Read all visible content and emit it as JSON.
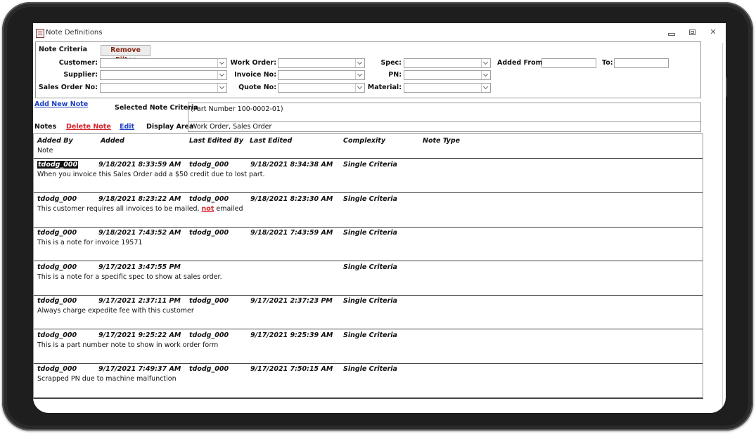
{
  "window": {
    "title": "Note Definitions"
  },
  "criteria": {
    "heading": "Note Criteria",
    "remove_filter": "Remove Filter",
    "labels": {
      "customer": "Customer:",
      "supplier": "Supplier:",
      "sales_order_no": "Sales Order No:",
      "work_order": "Work Order:",
      "invoice_no": "Invoice No:",
      "quote_no": "Quote No:",
      "spec": "Spec:",
      "pn": "PN:",
      "material": "Material:",
      "added_from": "Added From:",
      "to": "To:"
    }
  },
  "actions": {
    "add_new_note": "Add New Note",
    "selected_label": "Selected Note Criteria",
    "selected_value": "(Part Number 100-0002-01)",
    "notes_label": "Notes",
    "delete_note": "Delete Note",
    "edit": "Edit",
    "display_area_label": "Display Area",
    "display_area_value": "Work Order, Sales Order"
  },
  "grid": {
    "headers": {
      "added_by": "Added By",
      "added": "Added",
      "last_edited_by": "Last Edited By",
      "last_edited": "Last Edited",
      "complexity": "Complexity",
      "note_type": "Note Type",
      "note": "Note"
    },
    "rows": [
      {
        "added_by": "tdodg_000",
        "added": "9/18/2021 8:33:59 AM",
        "last_edited_by": "tdodg_000",
        "last_edited": "9/18/2021 8:34:38 AM",
        "complexity": "Single Criteria",
        "note": "When you invoice this Sales Order add a $50 credit due to lost part."
      },
      {
        "added_by": "tdodg_000",
        "added": "9/18/2021 8:23:22 AM",
        "last_edited_by": "tdodg_000",
        "last_edited": "9/18/2021 8:23:30 AM",
        "complexity": "Single Criteria",
        "note_pre": "This customer requires all invoices to be mailed, ",
        "note_emph": "not",
        "note_post": " emailed"
      },
      {
        "added_by": "tdodg_000",
        "added": "9/18/2021 7:43:52 AM",
        "last_edited_by": "tdodg_000",
        "last_edited": "9/18/2021 7:43:59 AM",
        "complexity": "Single Criteria",
        "note": "This is a note for invoice 19571"
      },
      {
        "added_by": "tdodg_000",
        "added": "9/17/2021 3:47:55 PM",
        "last_edited_by": "",
        "last_edited": "",
        "complexity": "Single Criteria",
        "note": "This is a note for a specific spec to show at sales order."
      },
      {
        "added_by": "tdodg_000",
        "added": "9/17/2021 2:37:11 PM",
        "last_edited_by": "tdodg_000",
        "last_edited": "9/17/2021 2:37:23 PM",
        "complexity": "Single Criteria",
        "note": "Always charge expedite fee with this customer"
      },
      {
        "added_by": "tdodg_000",
        "added": "9/17/2021 9:25:22 AM",
        "last_edited_by": "tdodg_000",
        "last_edited": "9/17/2021 9:25:39 AM",
        "complexity": "Single Criteria",
        "note": "This is a part number note to show in work order form"
      },
      {
        "added_by": "tdodg_000",
        "added": "9/17/2021 7:49:37 AM",
        "last_edited_by": "tdodg_000",
        "last_edited": "9/17/2021 7:50:15 AM",
        "complexity": "Single Criteria",
        "note": "Scrapped PN due to machine malfunction"
      }
    ]
  }
}
